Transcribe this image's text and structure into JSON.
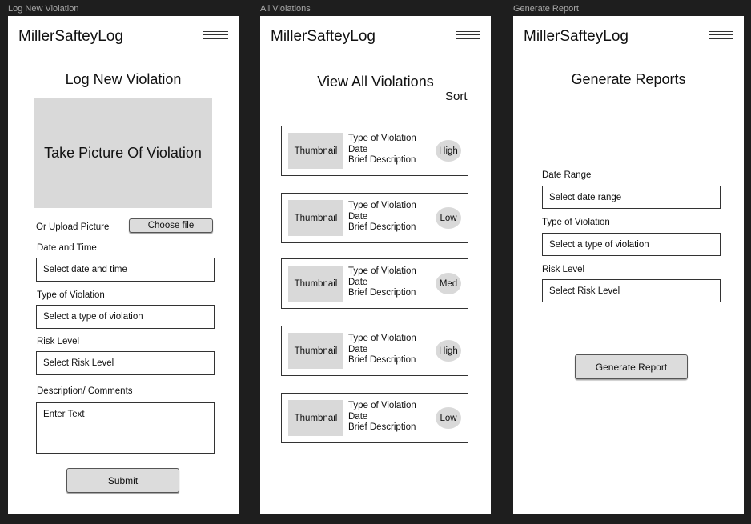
{
  "frames": {
    "log": {
      "frame_label": "Log New Violation",
      "logo": "MillerSafteyLog",
      "title": "Log New Violation",
      "photo_prompt": "Take Picture Of Violation",
      "upload_label": "Or Upload Picture",
      "choose_file": "Choose file",
      "date_label": "Date and Time",
      "date_placeholder": "Select date and time",
      "type_label": "Type of Violation",
      "type_placeholder": "Select a type of violation",
      "risk_label": "Risk Level",
      "risk_placeholder": "Select Risk Level",
      "desc_label": "Description/ Comments",
      "desc_placeholder": "Enter Text",
      "submit": "Submit"
    },
    "all": {
      "frame_label": "All Violations",
      "logo": "MillerSafteyLog",
      "title": "View All Violations",
      "sort": "Sort",
      "items": [
        {
          "thumb": "Thumbnail",
          "type": "Type of Violation",
          "date": "Date",
          "desc": "Brief Description",
          "risk": "High"
        },
        {
          "thumb": "Thumbnail",
          "type": "Type of Violation",
          "date": "Date",
          "desc": "Brief Description",
          "risk": "Low"
        },
        {
          "thumb": "Thumbnail",
          "type": "Type of Violation",
          "date": "Date",
          "desc": "Brief Description",
          "risk": "Med"
        },
        {
          "thumb": "Thumbnail",
          "type": "Type of Violation",
          "date": "Date",
          "desc": "Brief Description",
          "risk": "High"
        },
        {
          "thumb": "Thumbnail",
          "type": "Type of Violation",
          "date": "Date",
          "desc": "Brief Description",
          "risk": "Low"
        }
      ]
    },
    "report": {
      "frame_label": "Generate Report",
      "logo": "MillerSafteyLog",
      "title": "Generate Reports",
      "date_label": "Date Range",
      "date_placeholder": "Select date range",
      "type_label": "Type of Violation",
      "type_placeholder": "Select a type of violation",
      "risk_label": "Risk Level",
      "risk_placeholder": "Select Risk Level",
      "generate": "Generate Report"
    }
  },
  "icons": {
    "menu": "hamburger-menu-icon"
  },
  "colors": {
    "canvas": "#1e1e1e",
    "frame": "#ffffff",
    "placeholder_gray": "#d9d9d9",
    "button_gray": "#dcdcdc"
  }
}
